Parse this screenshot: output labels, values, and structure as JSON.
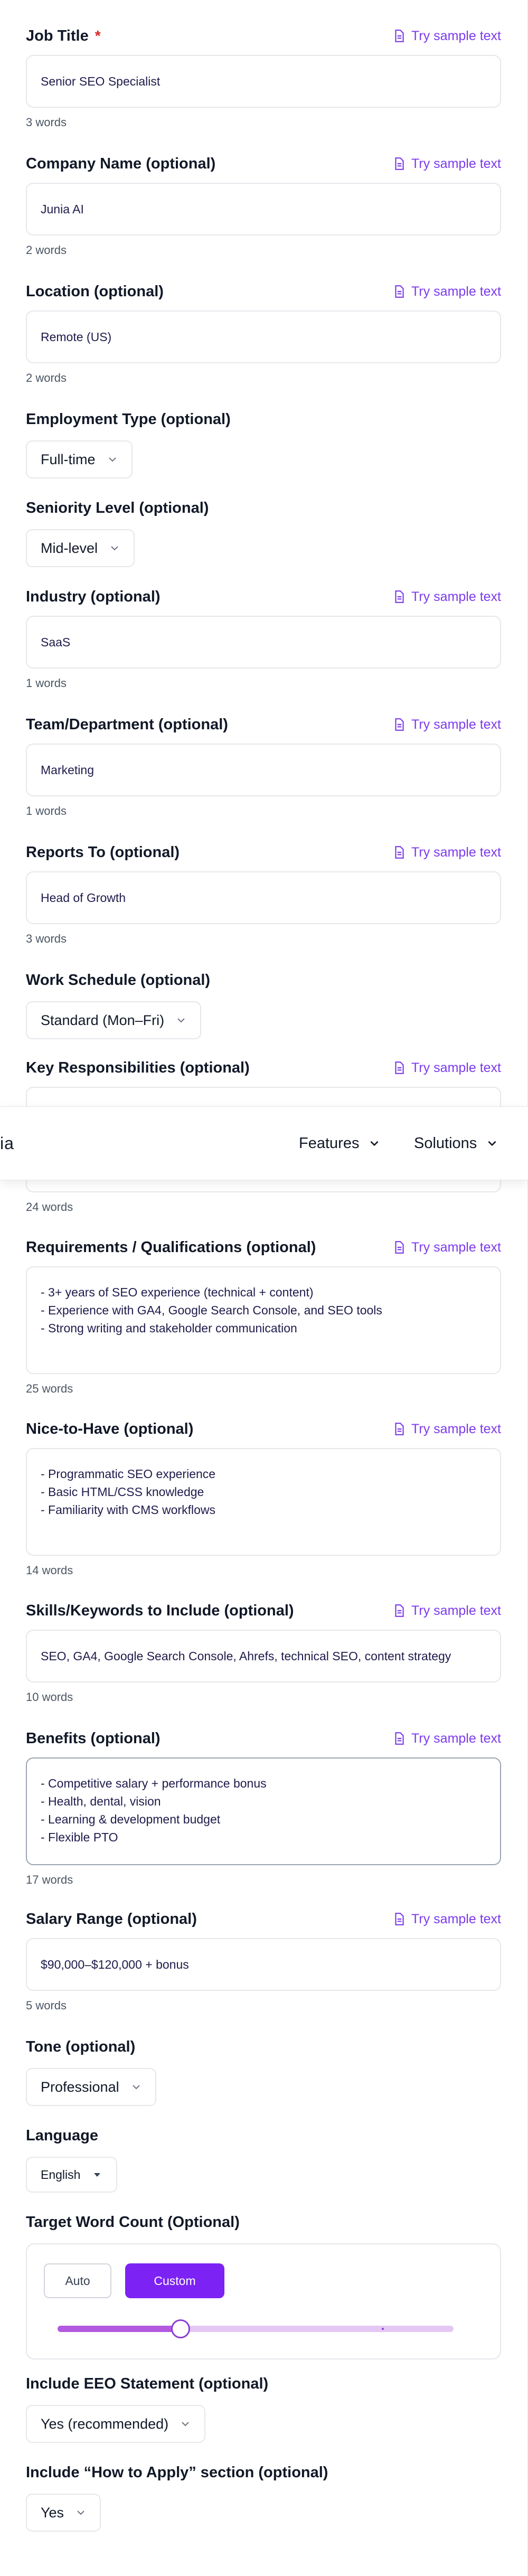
{
  "sample_text_label": "Try sample text",
  "fields": {
    "job_title": {
      "label": "Job Title",
      "required_mark": "*",
      "value": "Senior SEO Specialist",
      "count": "3 words"
    },
    "company": {
      "label": "Company Name (optional)",
      "value": "Junia AI",
      "count": "2 words"
    },
    "location": {
      "label": "Location (optional)",
      "value": "Remote (US)",
      "count": "2 words"
    },
    "employment": {
      "label": "Employment Type (optional)",
      "value": "Full-time"
    },
    "seniority": {
      "label": "Seniority Level (optional)",
      "value": "Mid-level"
    },
    "industry": {
      "label": "Industry (optional)",
      "value": "SaaS",
      "count": "1 words"
    },
    "team": {
      "label": "Team/Department (optional)",
      "value": "Marketing",
      "count": "1 words"
    },
    "reports_to": {
      "label": "Reports To (optional)",
      "value": "Head of Growth",
      "count": "3 words"
    },
    "schedule": {
      "label": "Work Schedule (optional)",
      "value": "Standard (Mon–Fri)"
    },
    "responsibilities": {
      "label": "Key Responsibilities (optional)",
      "count": "24 words"
    },
    "requirements": {
      "label": "Requirements / Qualifications (optional)",
      "lines": [
        "- 3+ years of SEO experience (technical + content)",
        "- Experience with GA4, Google Search Console, and SEO tools",
        "- Strong writing and stakeholder communication"
      ],
      "count": "25 words"
    },
    "nice_to_have": {
      "label": "Nice-to-Have (optional)",
      "lines": [
        "- Programmatic SEO experience",
        "- Basic HTML/CSS knowledge",
        "- Familiarity with CMS workflows"
      ],
      "count": "14 words"
    },
    "skills": {
      "label": "Skills/Keywords to Include (optional)",
      "value": "SEO, GA4, Google Search Console, Ahrefs, technical SEO, content strategy",
      "count": "10 words"
    },
    "benefits": {
      "label": "Benefits (optional)",
      "lines": [
        "- Competitive salary + performance bonus",
        "- Health, dental, vision",
        "- Learning & development budget",
        "- Flexible PTO"
      ],
      "count": "17 words"
    },
    "salary": {
      "label": "Salary Range (optional)",
      "value": "$90,000–$120,000 + bonus",
      "count": "5 words"
    },
    "tone": {
      "label": "Tone (optional)",
      "value": "Professional"
    },
    "language": {
      "label": "Language",
      "value": "English"
    },
    "word_count": {
      "label": "Target Word Count (Optional)",
      "auto_label": "Auto",
      "custom_label": "Custom",
      "slider_fraction": 0.31
    },
    "eeo": {
      "label": "Include EEO Statement (optional)",
      "value": "Yes (recommended)"
    },
    "how_to_apply": {
      "label": "Include “How to Apply” section (optional)",
      "value": "Yes"
    }
  },
  "navbar": {
    "logo_fragment": "ia",
    "features": "Features",
    "solutions": "Solutions"
  },
  "colors": {
    "accent": "#7c3aed",
    "button": "#7c22f5",
    "slider_fill": "#b35ae0",
    "slider_track": "#e4c7f5",
    "required": "#dc2626"
  }
}
